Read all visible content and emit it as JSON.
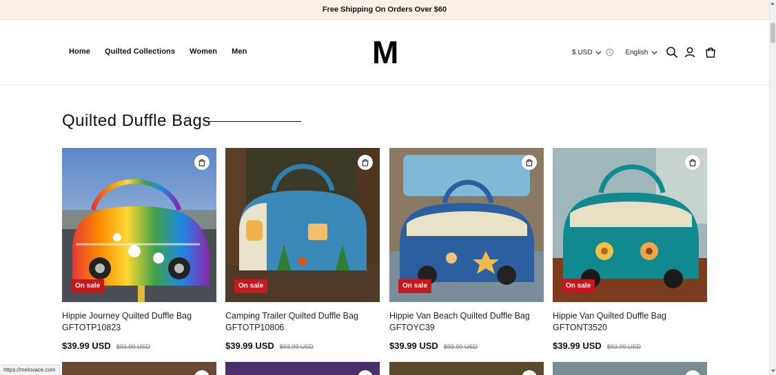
{
  "announcement": "Free Shipping On Orders Over $60",
  "nav": {
    "items": [
      "Home",
      "Quilted Collections",
      "Women",
      "Men"
    ]
  },
  "logo": "M",
  "header": {
    "currency": "$ USD",
    "language": "English"
  },
  "section": {
    "title": "Quilted Duffle Bags"
  },
  "products": [
    {
      "name": "Hippie Journey Quilted Duffle Bag GFTOTP10823",
      "price": "$39.99 USD",
      "compare": "$93.99 USD",
      "badge": "On sale"
    },
    {
      "name": "Camping Trailer Quilted Duffle Bag GFTOTP10806",
      "price": "$39.99 USD",
      "compare": "$93.99 USD",
      "badge": "On sale"
    },
    {
      "name": "Hippie Van Beach Quilted Duffle Bag GFTOYC39",
      "price": "$39.99 USD",
      "compare": "$93.99 USD",
      "badge": "On sale"
    },
    {
      "name": "Hippie Van Quilted Duffle Bag GFTONT3520",
      "price": "$39.99 USD",
      "compare": "$93.99 USD",
      "badge": "On sale"
    }
  ],
  "status_url": "https://melovace.com",
  "colors": {
    "announce_bg": "#fbf1e7",
    "sale_badge": "#c8181e"
  },
  "icons": [
    "chevron-down-icon",
    "info-icon",
    "search-icon",
    "account-icon",
    "cart-icon",
    "quick-add-bag-icon"
  ]
}
